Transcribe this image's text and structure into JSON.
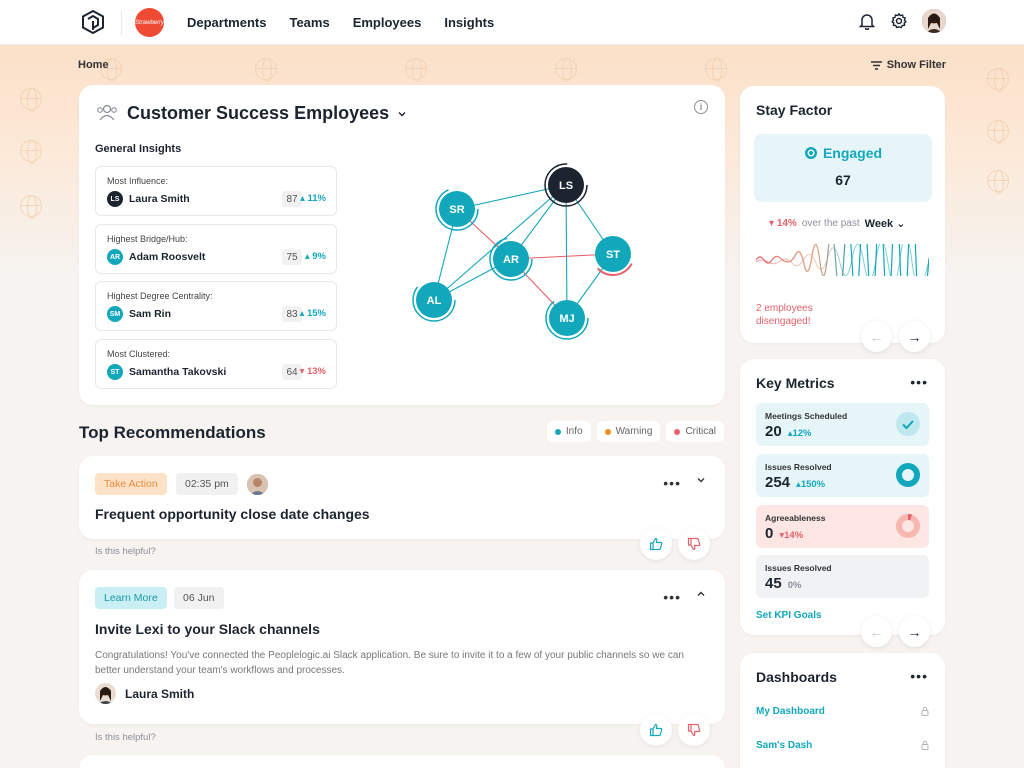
{
  "nav": {
    "brand_text": "Strawberry",
    "links": [
      "Departments",
      "Teams",
      "Employees",
      "Insights"
    ]
  },
  "breadcrumb": "Home",
  "show_filter": "Show Filter",
  "insights": {
    "title": "Customer Success Employees",
    "section_label": "General Insights",
    "metrics": [
      {
        "label": "Most Influence:",
        "initials": "LS",
        "name": "Laura Smith",
        "score": "87",
        "delta": "11%",
        "direction": "up",
        "color": "#1c2430"
      },
      {
        "label": "Highest Bridge/Hub:",
        "initials": "AR",
        "name": "Adam Roosvelt",
        "score": "75",
        "delta": "9%",
        "direction": "up",
        "color": "#12a7bb"
      },
      {
        "label": "Highest Degree Centrality:",
        "initials": "SM",
        "name": "Sam Rin",
        "score": "83",
        "delta": "15%",
        "direction": "up",
        "color": "#12a7bb"
      },
      {
        "label": "Most Clustered:",
        "initials": "ST",
        "name": "Samantha Takovski",
        "score": "64",
        "delta": "13%",
        "direction": "down",
        "color": "#12a7bb"
      }
    ],
    "network_nodes": [
      "LS",
      "SR",
      "AR",
      "ST",
      "AL",
      "MJ"
    ]
  },
  "recommendations": {
    "title": "Top Recommendations",
    "legend": [
      {
        "label": "Info",
        "color": "#12a7bb"
      },
      {
        "label": "Warning",
        "color": "#f08a2a"
      },
      {
        "label": "Critical",
        "color": "#e5606a"
      }
    ],
    "items": [
      {
        "tag": "Take Action",
        "time": "02:35 pm",
        "title": "Frequent opportunity close date changes",
        "helpful": "Is this helpful?"
      },
      {
        "tag": "Learn More",
        "time": "06 Jun",
        "title": "Invite Lexi to your Slack channels",
        "body": "Congratulations! You've connected the Peoplelogic.ai Slack application. Be sure to invite it to a few of your public channels so we can better understand your team's workflows and processes.",
        "person": "Laura Smith",
        "helpful": "Is this helpful?"
      }
    ]
  },
  "stay_factor": {
    "title": "Stay Factor",
    "status": "Engaged",
    "value": "67",
    "delta": "14%",
    "delta_text": "over the past",
    "period": "Week",
    "disengaged": "2 employees disengaged!"
  },
  "key_metrics": {
    "title": "Key Metrics",
    "items": [
      {
        "label": "Meetings Scheduled",
        "value": "20",
        "delta": "12%",
        "direction": "up",
        "bg": "#e6f6f8"
      },
      {
        "label": "Issues Resolved",
        "value": "254",
        "delta": "150%",
        "direction": "up",
        "bg": "#e6f6f8"
      },
      {
        "label": "Agreeableness",
        "value": "0",
        "delta": "14%",
        "direction": "down",
        "bg": "#fde6e4"
      },
      {
        "label": "Issues Resolved",
        "value": "45",
        "delta": "0%",
        "direction": "flat",
        "bg": "#f1f2f4"
      }
    ],
    "link": "Set KPI Goals"
  },
  "dashboards": {
    "title": "Dashboards",
    "items": [
      "My Dashboard",
      "Sam's Dash"
    ]
  }
}
